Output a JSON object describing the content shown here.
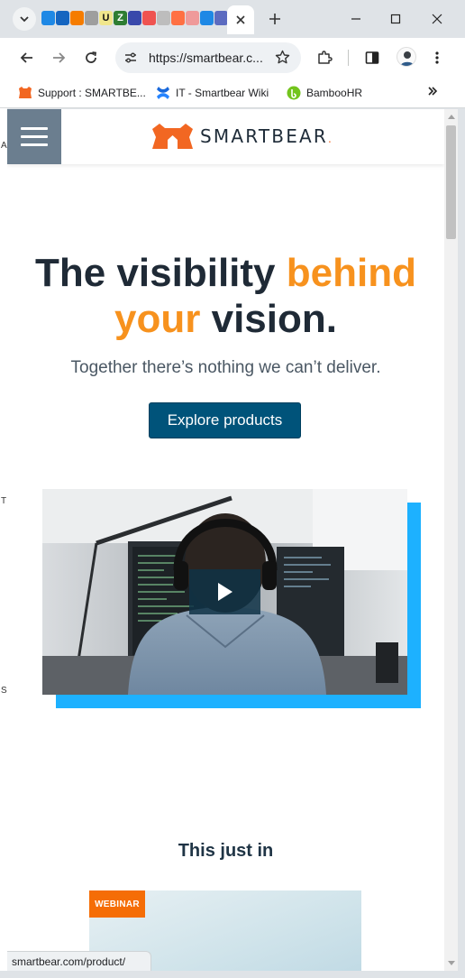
{
  "browser": {
    "url": "https://smartbear.c...",
    "status_url": "smartbear.com/product/",
    "bookmarks": [
      {
        "label": "Support : SMARTBE..."
      },
      {
        "label": "IT - Smartbear Wiki"
      },
      {
        "label": "BambooHR"
      }
    ],
    "favicon_colors": [
      "#1e88e5",
      "#1565c0",
      "#f57c00",
      "#9e9e9e",
      "#263238",
      "#1565c0",
      "#3949ab",
      "#ef5350",
      "#bdbdbd",
      "#ff7043",
      "#ef9a9a",
      "#1e88e5",
      "#5c6bc0"
    ],
    "favicon_labels": [
      "U",
      "Z"
    ]
  },
  "site": {
    "logo_text": "SMARTBEAR",
    "logo_mark": ".",
    "brand_color": "#f7921e",
    "hero": {
      "title_part1": "The visibility ",
      "title_accent1": "behind",
      "title_accent2": "your",
      "title_part2": " vision.",
      "subtitle": "Together there’s nothing we can’t deliver.",
      "cta": "Explore products"
    },
    "section_title": "This just in",
    "card_badge": "WEBINAR"
  },
  "edge_letters": [
    "A",
    "T",
    "S"
  ]
}
